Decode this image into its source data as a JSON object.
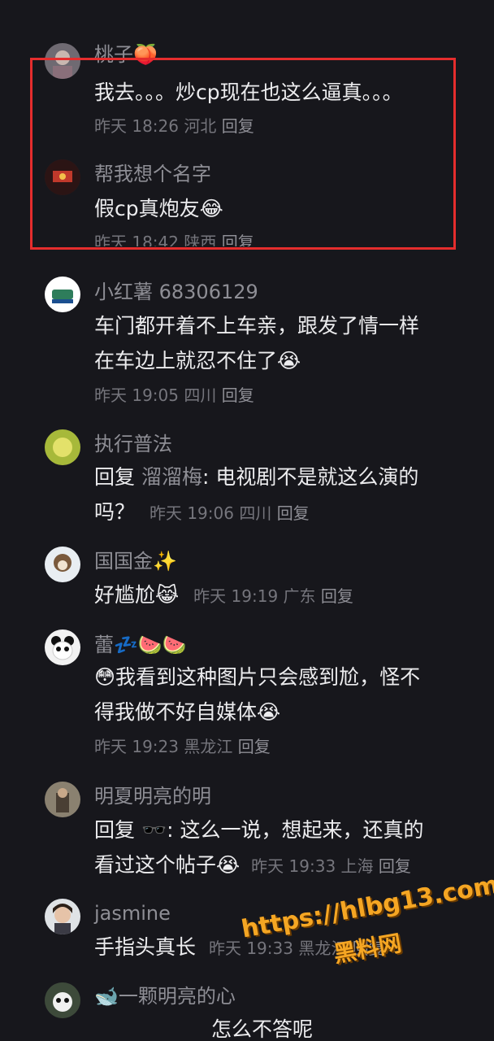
{
  "comments": [
    {
      "user": "桃子🍑",
      "text": "我去。。。炒cp现在也这么逼真。。。",
      "time": "昨天 18:26",
      "region": "河北",
      "reply": "回复"
    },
    {
      "user": "帮我想个名字",
      "text": "假cp真炮友😂",
      "time": "昨天 18:42",
      "region": "陕西",
      "reply": "回复"
    },
    {
      "user": "小红薯 68306129",
      "text_line1": "车门都开着不上车亲，跟发了情一样",
      "text_line2": "在车边上就忍不住了😭",
      "time": "昨天 19:05",
      "region": "四川",
      "reply": "回复"
    },
    {
      "user": "执行普法",
      "reply_prefix": "回复",
      "mention": "溜溜梅",
      "text_line1": ": 电视剧不是就这么演的",
      "text_line2": "吗？",
      "time": "昨天 19:06",
      "region": "四川",
      "reply": "回复"
    },
    {
      "user": "国国金✨",
      "text": "好尴尬😹",
      "time": "昨天 19:19",
      "region": "广东",
      "reply": "回复"
    },
    {
      "user": "蕾💤🍉🍉",
      "text_line1": "😳我看到这种图片只会感到尬，怪不",
      "text_line2": "得我做不好自媒体😭",
      "time": "昨天 19:23",
      "region": "黑龙江",
      "reply": "回复"
    },
    {
      "user": "明夏明亮的明",
      "reply_prefix": "回复",
      "mention": "🕶️",
      "text_line1": ": 这么一说，想起来，还真的",
      "text_line2": "看过这个帖子😭",
      "time": "昨天 19:33",
      "region": "上海",
      "reply": "回复"
    },
    {
      "user": "jasmine",
      "text": "手指头真长",
      "time": "昨天 19:33",
      "region": "黑龙江",
      "reply": "回复"
    },
    {
      "user": "🐋一颗明亮的心",
      "text": "怎么不答呢"
    }
  ],
  "watermark": {
    "url": "https://hlbg13.com",
    "label": "黑料网"
  },
  "colors": {
    "background": "#17171c",
    "highlight_border": "#e52d2d",
    "watermark": "#f5a623"
  }
}
